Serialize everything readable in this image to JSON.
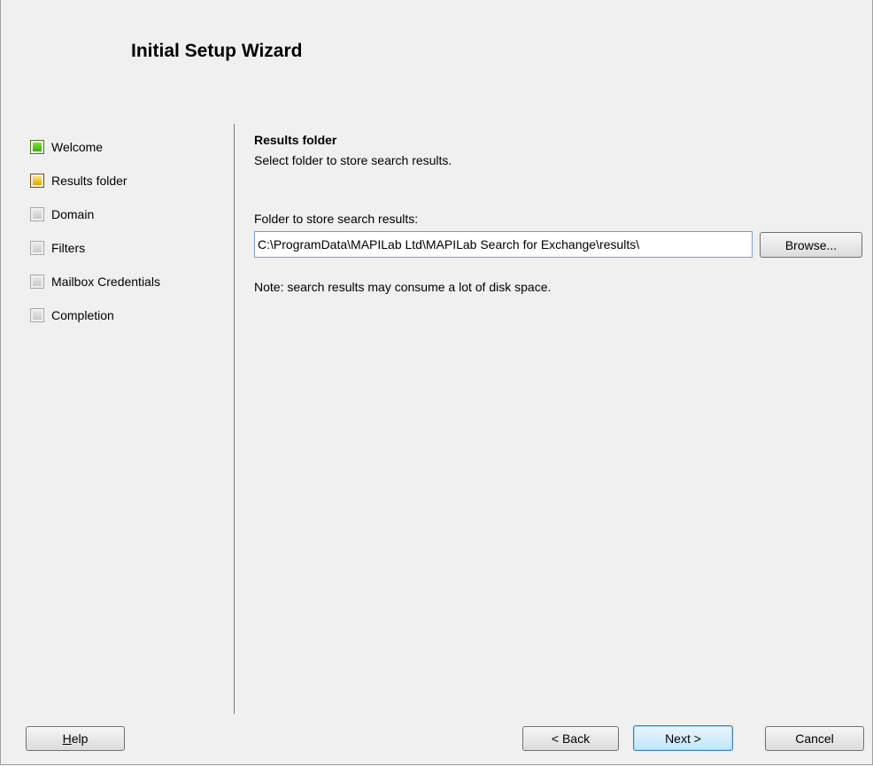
{
  "wizard": {
    "title": "Initial Setup Wizard"
  },
  "steps": [
    {
      "label": "Welcome",
      "status": "done",
      "color": "#4fc21a"
    },
    {
      "label": "Results folder",
      "status": "current",
      "color": "#f0b800"
    },
    {
      "label": "Domain",
      "status": "pending",
      "color": "#c8c8c8"
    },
    {
      "label": "Filters",
      "status": "pending",
      "color": "#c8c8c8"
    },
    {
      "label": "Mailbox Credentials",
      "status": "pending",
      "color": "#c8c8c8"
    },
    {
      "label": "Completion",
      "status": "pending",
      "color": "#c8c8c8"
    }
  ],
  "page": {
    "heading": "Results folder",
    "description": "Select folder to store search results.",
    "folder_label": "Folder to store search results:",
    "folder_value": "C:\\ProgramData\\MAPILab Ltd\\MAPILab Search for Exchange\\results\\",
    "browse_label": "Browse...",
    "note": "Note: search results may consume a lot of disk space."
  },
  "buttons": {
    "help_accel": "H",
    "help_rest": "elp",
    "back": "< Back",
    "next": "Next >",
    "cancel": "Cancel"
  }
}
